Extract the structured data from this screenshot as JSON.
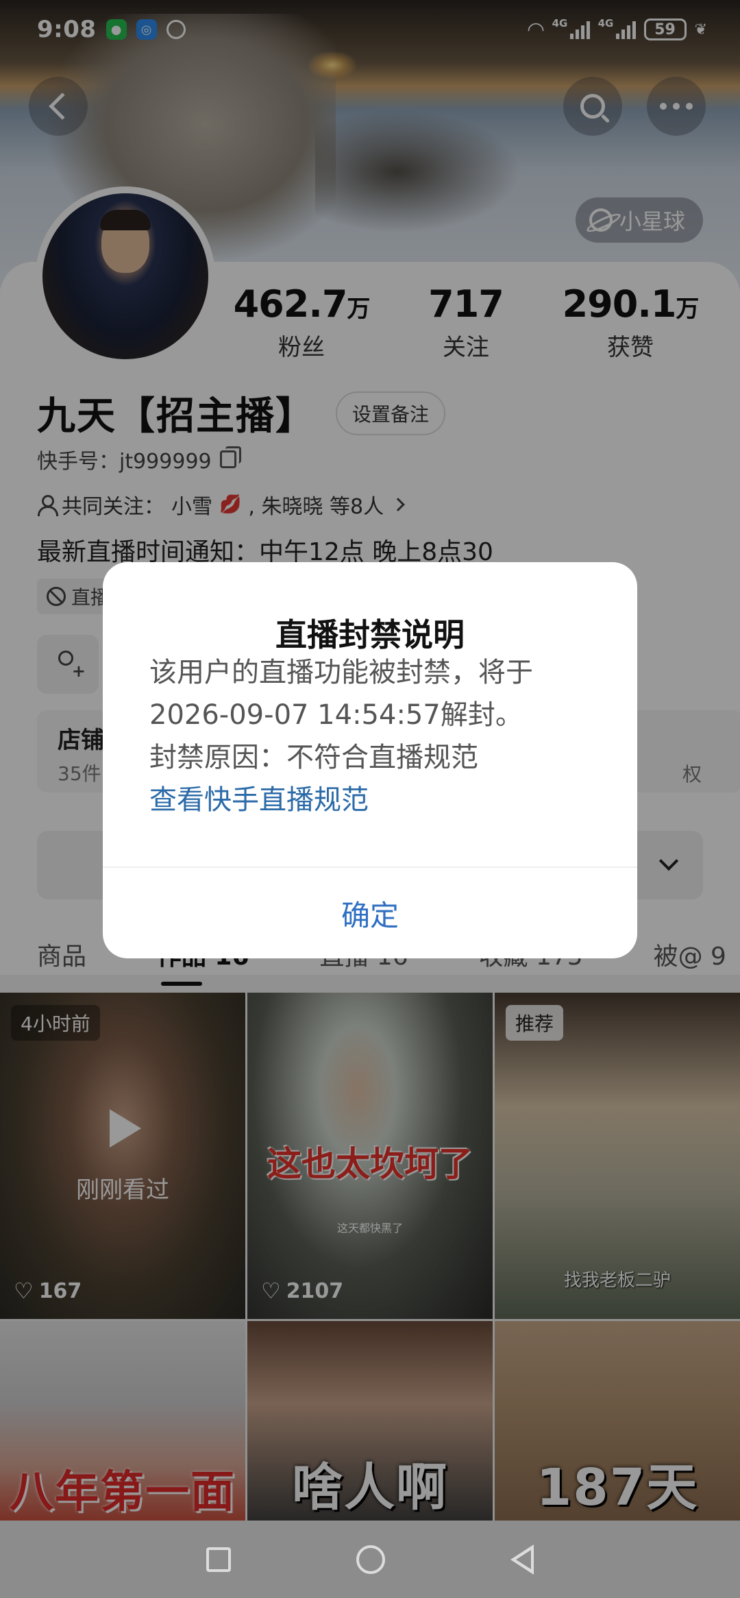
{
  "status_bar": {
    "time": "9:08",
    "signal1_tag": "4G",
    "signal2_tag": "4G",
    "battery": "59"
  },
  "header": {
    "planet_label": "小星球"
  },
  "profile": {
    "stats": [
      {
        "value": "462.7",
        "unit": "万",
        "label": "粉丝"
      },
      {
        "value": "717",
        "unit": "",
        "label": "关注"
      },
      {
        "value": "290.1",
        "unit": "万",
        "label": "获赞"
      }
    ],
    "name": "九天【招主播】",
    "remark_button": "设置备注",
    "kuaishou_id": "快手号：jt999999",
    "mutual_prefix": "共同关注：",
    "mutual_names": "小雪",
    "mutual_rest": ", 朱晓晓 等8人",
    "bio": "最新直播时间通知：中午12点 晚上8点30",
    "ban_tag": "直播",
    "shop_title": "店铺",
    "shop_sub": "35件",
    "shop_right": "权"
  },
  "tabs": [
    {
      "label": "商品"
    },
    {
      "label": "作品 16"
    },
    {
      "label": "直播 16"
    },
    {
      "label": "收藏 175"
    },
    {
      "label": "被@ 9"
    }
  ],
  "grid": [
    {
      "tag": "4小时前",
      "overlay": "刚刚看过",
      "likes": "167"
    },
    {
      "caption": "这也太坎坷了",
      "small": "这天都快黑了",
      "likes": "2107"
    },
    {
      "tag": "推荐",
      "caption": "找我老板二驴"
    },
    {
      "caption": "八年第一面"
    },
    {
      "caption": "啥人啊"
    },
    {
      "caption": "187天"
    }
  ],
  "dialog": {
    "title": "直播封禁说明",
    "line1": "该用户的直播功能被封禁，将于",
    "line2": "2026-09-07 14:54:57解封。",
    "line3": "封禁原因：不符合直播规范",
    "link": "查看快手直播规范",
    "ok": "确定"
  },
  "colors": {
    "link": "#2b6aa8",
    "ok_button": "#2f6fc2",
    "scrim": "rgba(0,0,0,0.40)"
  }
}
